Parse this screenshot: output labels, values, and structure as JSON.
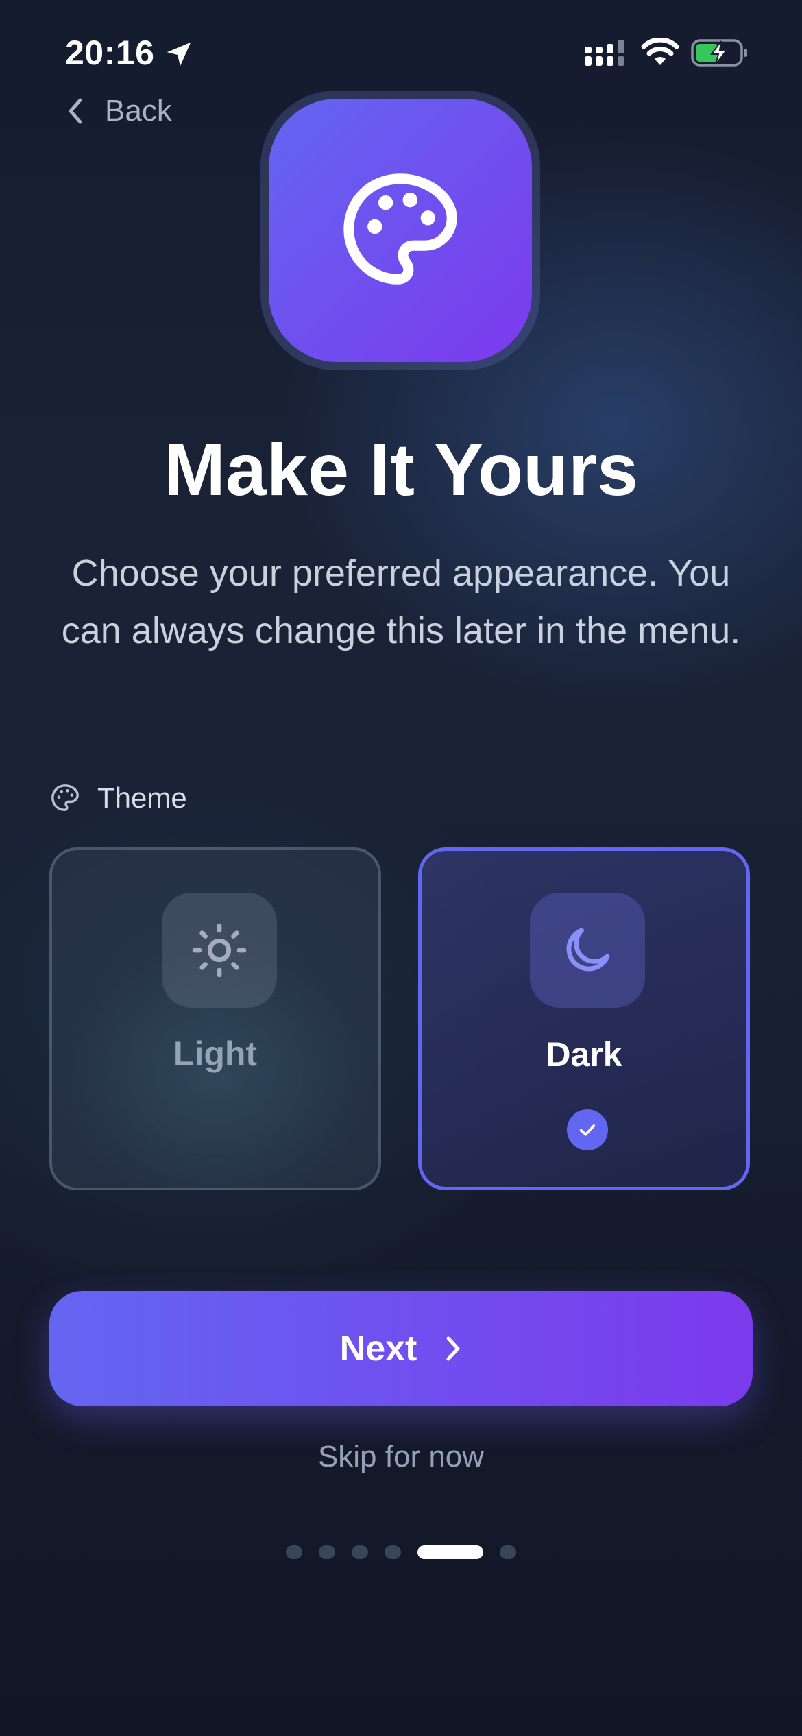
{
  "status_bar": {
    "time": "20:16"
  },
  "nav": {
    "back_label": "Back"
  },
  "hero": {
    "icon": "palette-icon",
    "tile_gradient": [
      "#6366f1",
      "#7c3aed"
    ]
  },
  "title": "Make It Yours",
  "subtitle": "Choose your preferred appearance. You can always change this later in the menu.",
  "theme_section": {
    "label": "Theme",
    "options": [
      {
        "label": "Light",
        "icon": "sun-icon",
        "selected": false
      },
      {
        "label": "Dark",
        "icon": "moon-icon",
        "selected": true
      }
    ]
  },
  "actions": {
    "next_label": "Next",
    "skip_label": "Skip for now"
  },
  "pagination": {
    "total": 6,
    "current": 5
  },
  "colors": {
    "accent": "#6366f1",
    "accent_end": "#7c3aed"
  }
}
